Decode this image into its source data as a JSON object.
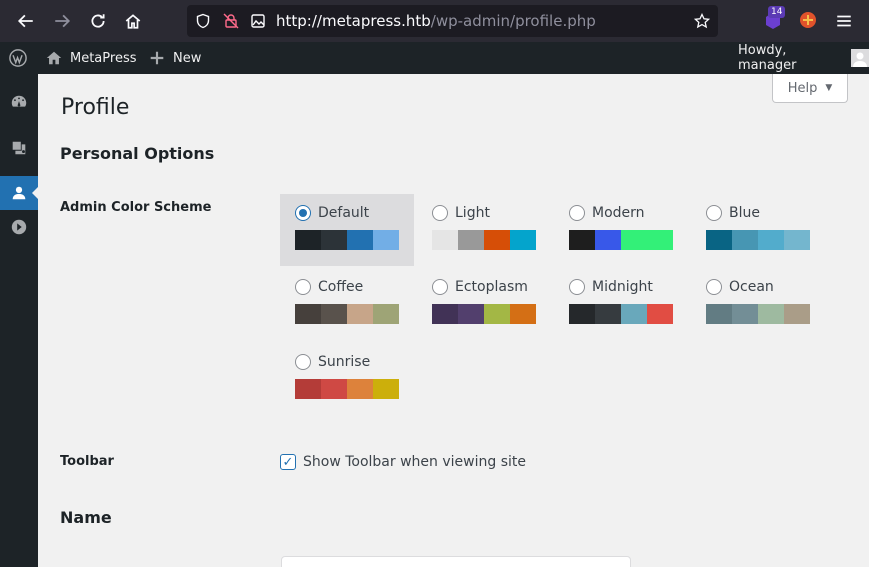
{
  "browser": {
    "url_host": "http://metapress.htb",
    "url_path": "/wp-admin/profile.php",
    "extension_badge": "14"
  },
  "adminbar": {
    "site_name": "MetaPress",
    "new_label": "New",
    "howdy": "Howdy, manager"
  },
  "help": {
    "label": "Help"
  },
  "page": {
    "title": "Profile",
    "personal_options": "Personal Options",
    "admin_color_scheme": "Admin Color Scheme",
    "toolbar_label": "Toolbar",
    "toolbar_option": "Show Toolbar when viewing site",
    "name_heading": "Name"
  },
  "schemes": [
    {
      "name": "Default",
      "selected": true,
      "colors": [
        "#1d2327",
        "#2c3338",
        "#2271b1",
        "#72aee6"
      ]
    },
    {
      "name": "Light",
      "selected": false,
      "colors": [
        "#e5e5e5",
        "#999999",
        "#d64e07",
        "#04a4cc"
      ]
    },
    {
      "name": "Modern",
      "selected": false,
      "colors": [
        "#1e1e1e",
        "#3858e9",
        "#33f078",
        "#33f078"
      ]
    },
    {
      "name": "Blue",
      "selected": false,
      "colors": [
        "#096484",
        "#4796b3",
        "#52accc",
        "#74b6ce"
      ]
    },
    {
      "name": "Coffee",
      "selected": false,
      "colors": [
        "#46403c",
        "#59524c",
        "#c7a589",
        "#9ea476"
      ]
    },
    {
      "name": "Ectoplasm",
      "selected": false,
      "colors": [
        "#413256",
        "#523f6d",
        "#a3b745",
        "#d46f15"
      ]
    },
    {
      "name": "Midnight",
      "selected": false,
      "colors": [
        "#25282b",
        "#363b3f",
        "#69a8bb",
        "#e14d43"
      ]
    },
    {
      "name": "Ocean",
      "selected": false,
      "colors": [
        "#627c83",
        "#738e96",
        "#9ebaa0",
        "#aa9d88"
      ]
    },
    {
      "name": "Sunrise",
      "selected": false,
      "colors": [
        "#b43c38",
        "#cf4944",
        "#dd823b",
        "#ccaf0b"
      ]
    }
  ],
  "toolbar_checked": true
}
